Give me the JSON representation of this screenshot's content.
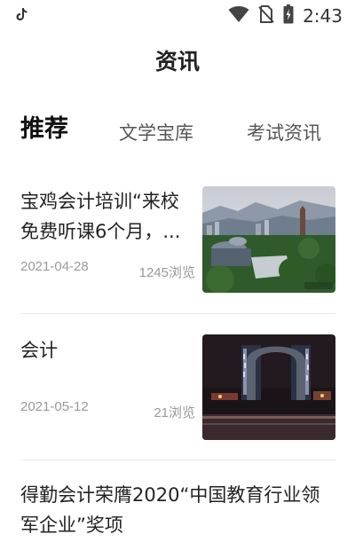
{
  "status_bar": {
    "time": "2:43",
    "icons": [
      "tiktok-icon",
      "wifi-icon",
      "no-sim-icon",
      "battery-icon"
    ]
  },
  "page": {
    "title": "资讯"
  },
  "tabs": [
    {
      "label": "推荐",
      "active": true
    },
    {
      "label": "文学宝库",
      "active": false
    },
    {
      "label": "考试资讯",
      "active": false
    }
  ],
  "news": [
    {
      "title": "宝鸡会计培训“来校免费听课6个月，...",
      "date": "2021-04-28",
      "views": "1245浏览",
      "thumbnail": "city-landscape-image"
    },
    {
      "title": "会计",
      "date": "2021-05-12",
      "views": "21浏览",
      "thumbnail": "night-arch-building-image"
    },
    {
      "title": "得勤会计荣膺2020“中国教育行业领军企业”奖项"
    }
  ],
  "colors": {
    "text_primary": "#222222",
    "text_secondary": "#999999",
    "divider": "#e8e8e8",
    "background": "#ffffff"
  }
}
